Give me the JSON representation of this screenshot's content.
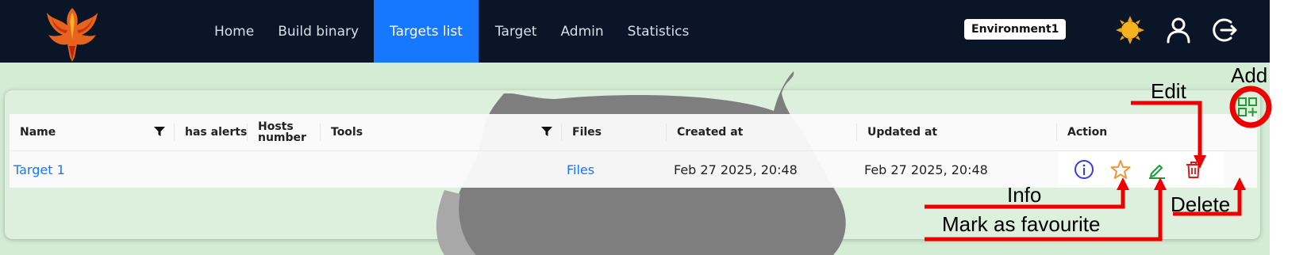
{
  "navbar": {
    "items": [
      {
        "label": "Home"
      },
      {
        "label": "Build binary"
      },
      {
        "label": "Targets list",
        "active": true
      },
      {
        "label": "Target"
      },
      {
        "label": "Admin"
      },
      {
        "label": "Statistics"
      }
    ],
    "environment": "Environment1",
    "icons": [
      "theme-sun-icon",
      "user-icon",
      "logout-icon"
    ]
  },
  "table": {
    "columns": {
      "name": "Name",
      "alerts": "has alerts",
      "hosts_line1": "Hosts",
      "hosts_line2": "number",
      "tools": "Tools",
      "files": "Files",
      "created": "Created at",
      "updated": "Updated at",
      "action": "Action"
    },
    "rows": [
      {
        "name": "Target 1",
        "alerts": "",
        "hosts": "",
        "tools": "",
        "files": "Files",
        "created": "Feb 27 2025, 20:48",
        "updated": "Feb 27 2025, 20:48",
        "actions": [
          "info-icon",
          "star-icon",
          "edit-icon",
          "delete-icon"
        ]
      }
    ]
  },
  "annotations": {
    "add": "Add",
    "edit": "Edit",
    "info": "Info",
    "delete": "Delete",
    "favourite": "Mark as favourite"
  },
  "colors": {
    "navbar": "#0a1628",
    "active_tab": "#1677ff",
    "link": "#1677ff",
    "annotation": "#ee0000",
    "content_bg": "#d4ecd4",
    "info": "#3b3bd6",
    "favourite": "#f0953a",
    "edit": "#1f9d34",
    "delete": "#d91a1a"
  }
}
